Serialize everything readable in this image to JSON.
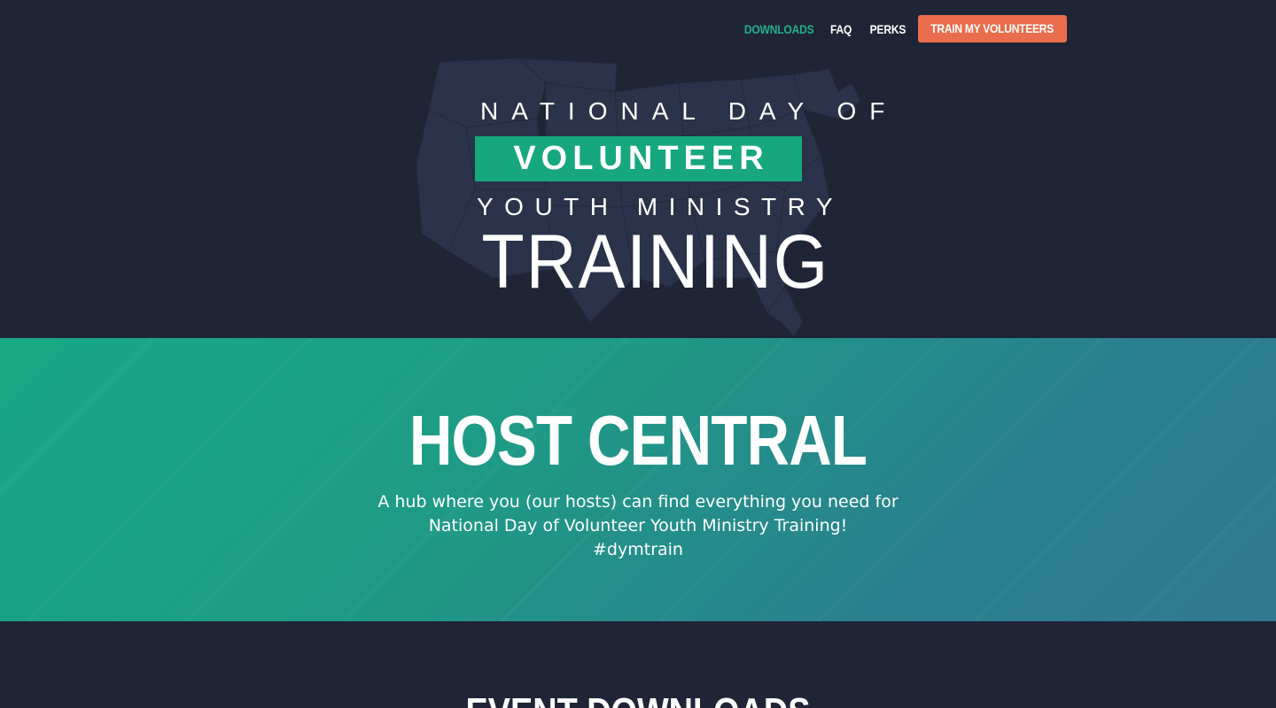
{
  "nav": {
    "links": [
      {
        "label": "DOWNLOADS",
        "active": true
      },
      {
        "label": "FAQ",
        "active": false
      },
      {
        "label": "PERKS",
        "active": false
      }
    ],
    "cta_label": "TRAIN MY VOLUNTEERS"
  },
  "logo": {
    "line1": "NATIONAL DAY OF",
    "line2": "VOLUNTEER",
    "line3": "YOUTH MINISTRY",
    "line4": "TRAINING"
  },
  "host": {
    "title": "HOST CENTRAL",
    "subtitle_line1": "A hub where you (our hosts) can find everything you need for",
    "subtitle_line2": "National Day of Volunteer Youth Ministry Training!",
    "hashtag": "#dymtrain"
  },
  "downloads": {
    "title": "EVENT DOWNLOADS"
  },
  "colors": {
    "background": "#1f2536",
    "accent_green": "#16a77f",
    "cta_orange": "#e96d4c",
    "band_gradient_start": "#17a984",
    "band_gradient_end": "#2f7a8f"
  },
  "icons": {
    "hero_map": "usa-map-graphic"
  }
}
